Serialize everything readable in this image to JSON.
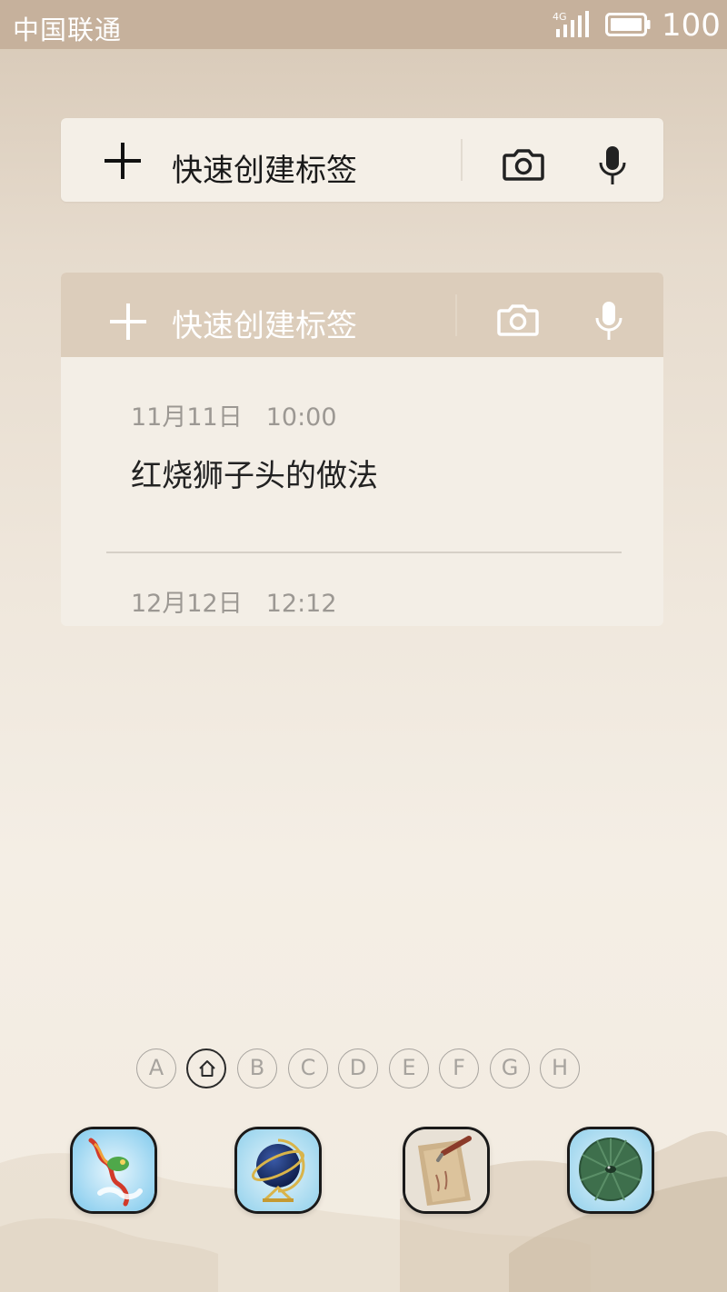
{
  "status_bar": {
    "carrier": "中国联通",
    "network": "4G",
    "battery_percent": "100"
  },
  "widget_quick_create": {
    "label": "快速创建标签",
    "add_icon": "plus-icon",
    "camera_icon": "camera-icon",
    "mic_icon": "microphone-icon"
  },
  "widget_notes": {
    "header_label": "快速创建标签",
    "notes": [
      {
        "date": "11月11日",
        "time": "10:00",
        "title": "红烧狮子头的做法"
      },
      {
        "date": "12月12日",
        "time": "12:12"
      }
    ]
  },
  "page_indicator": {
    "pages": [
      "A",
      "home",
      "B",
      "C",
      "D",
      "E",
      "F",
      "G",
      "H"
    ],
    "active": "home"
  },
  "dock": {
    "apps": [
      {
        "icon": "dragon-icon"
      },
      {
        "icon": "globe-icon"
      },
      {
        "icon": "scroll-brush-icon"
      },
      {
        "icon": "lotus-leaf-icon"
      }
    ]
  }
}
